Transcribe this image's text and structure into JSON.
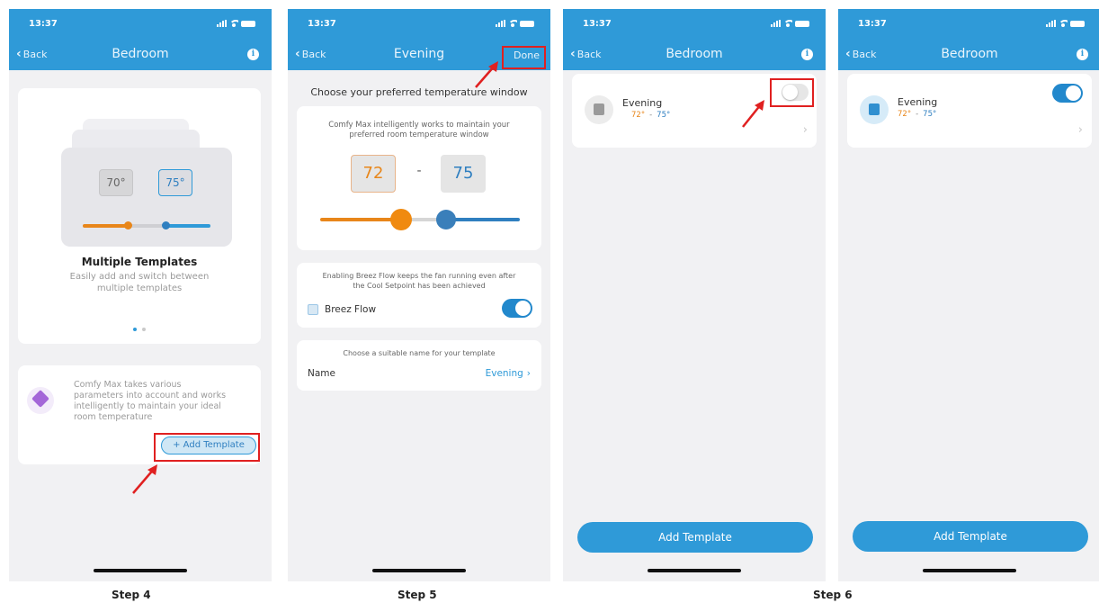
{
  "status": {
    "time": "13:37"
  },
  "nav": {
    "back": "Back"
  },
  "colors": {
    "primary": "#2f9ad8",
    "heat": "#e8861a",
    "cool": "#2f7fc0",
    "highlight": "#e02020"
  },
  "step4": {
    "title": "Bedroom",
    "preview": {
      "low": "70°",
      "high": "75°"
    },
    "carousel_title": "Multiple Templates",
    "carousel_text_1": "Easily add and switch between",
    "carousel_text_2": "multiple templates",
    "info_text": [
      "Comfy Max takes various",
      "parameters into account and works",
      "intelligently to maintain your ideal",
      "room temperature"
    ],
    "add_button": "+ Add Template",
    "label": "Step 4"
  },
  "step5": {
    "title": "Evening",
    "done": "Done",
    "heading": "Choose your preferred temperature window",
    "desc_1": "Comfy Max intelligently works to maintain your",
    "desc_2": "preferred room temperature window",
    "low": "72",
    "dash": "-",
    "high": "75",
    "breez_desc_1": "Enabling Breez Flow keeps the fan running even after",
    "breez_desc_2": "the Cool Setpoint has been achieved",
    "breez_label": "Breez Flow",
    "name_hint": "Choose a suitable name for your template",
    "name_label": "Name",
    "name_value": "Evening",
    "label": "Step 5"
  },
  "step6": {
    "title": "Bedroom",
    "template_name": "Evening",
    "temp_low": "72°",
    "temp_sep": "-",
    "temp_high": "75°",
    "add_button": "Add Template",
    "label": "Step 6"
  },
  "icons": {
    "info": "i",
    "chevron_right": "›",
    "chevron_back": "‹"
  }
}
